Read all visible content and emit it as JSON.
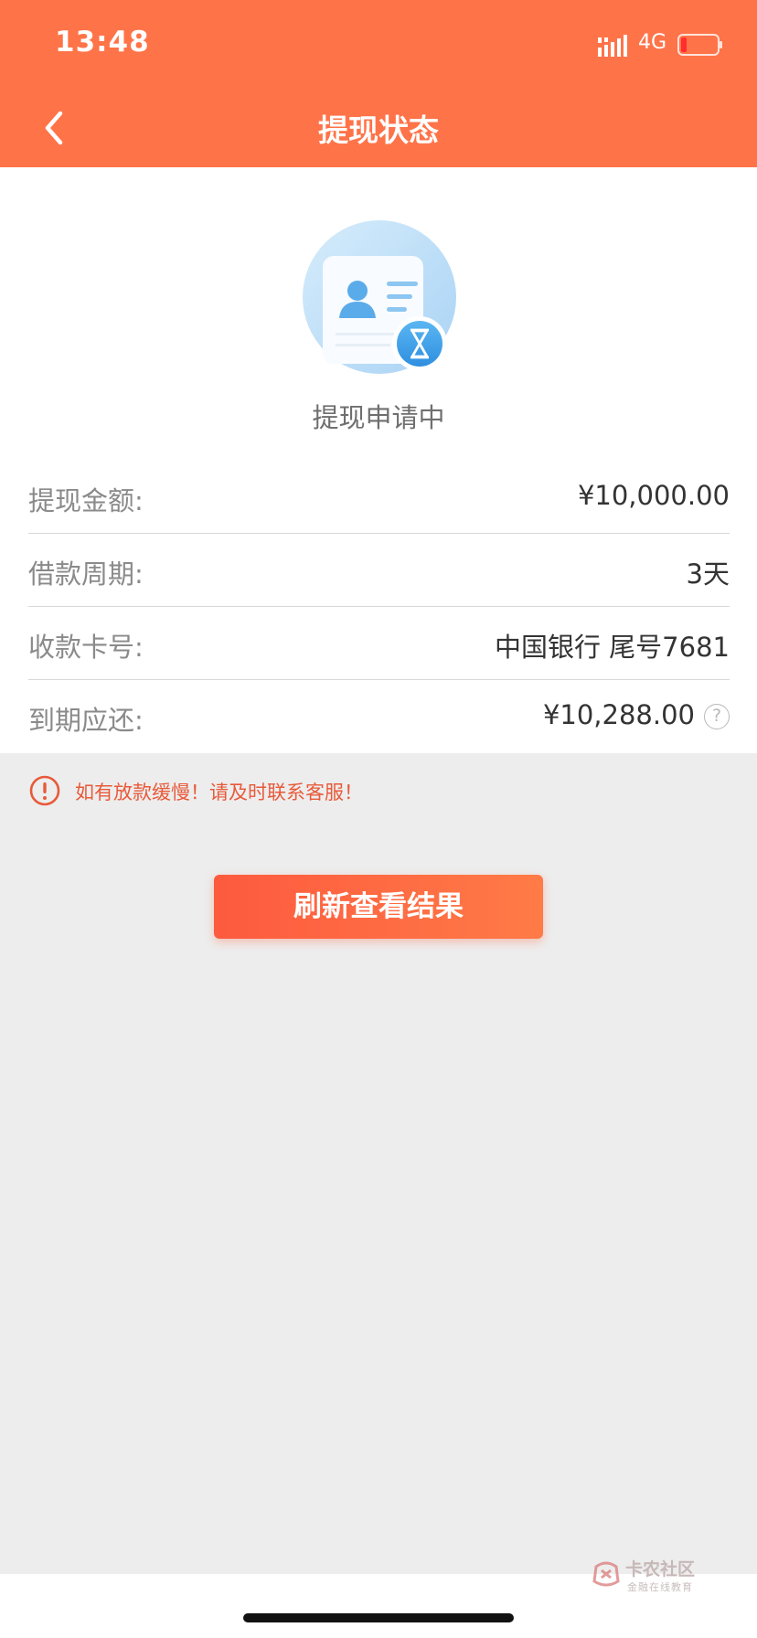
{
  "status_bar": {
    "time": "13:48",
    "network": "4G"
  },
  "nav": {
    "title": "提现状态",
    "back_icon": "chevron-left-icon"
  },
  "status": {
    "text": "提现申请中",
    "icon": "id-card-hourglass-icon"
  },
  "details": {
    "rows": [
      {
        "label": "提现金额:",
        "value": "¥10,000.00"
      },
      {
        "label": "借款周期:",
        "value": "3天"
      },
      {
        "label": "收款卡号:",
        "value": "中国银行 尾号7681"
      },
      {
        "label": "到期应还:",
        "value": "¥10,288.00"
      }
    ],
    "help_glyph": "?"
  },
  "notice": {
    "text": "如有放款缓慢！请及时联系客服！",
    "icon": "info-circle-icon"
  },
  "actions": {
    "refresh_label": "刷新查看结果"
  },
  "watermark": {
    "title": "卡农社区",
    "subtitle": "金融在线教育"
  },
  "colors": {
    "accent": "#ff7348",
    "warning": "#e85a3a"
  }
}
